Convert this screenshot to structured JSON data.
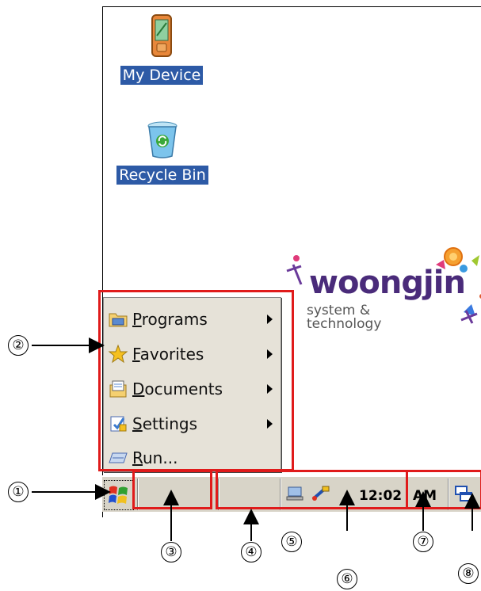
{
  "desktop": {
    "icons": [
      {
        "label": "My Device",
        "icon": "pda-icon"
      },
      {
        "label": "Recycle Bin",
        "icon": "recycle-bin-icon"
      }
    ],
    "logo": {
      "brand": "woongjin",
      "tagline_line1": "system &",
      "tagline_line2": "technology"
    }
  },
  "start_menu": {
    "items": [
      {
        "label": "Programs",
        "icon": "programs-folder-icon",
        "has_submenu": true
      },
      {
        "label": "Favorites",
        "icon": "star-icon",
        "has_submenu": true
      },
      {
        "label": "Documents",
        "icon": "documents-icon",
        "has_submenu": true
      },
      {
        "label": "Settings",
        "icon": "settings-icon",
        "has_submenu": true
      },
      {
        "label": "Run...",
        "icon": "run-icon",
        "has_submenu": false
      }
    ]
  },
  "taskbar": {
    "time": "12:02",
    "ampm": "AM",
    "start_icon": "windows-flag-icon",
    "tray_icons": [
      "network-icon",
      "usb-sync-icon",
      "desktop-switch-icon"
    ]
  },
  "callouts": [
    "①",
    "②",
    "③",
    "④",
    "⑤",
    "⑥",
    "⑦",
    "⑧"
  ],
  "annotation_color": "#e01b1b"
}
